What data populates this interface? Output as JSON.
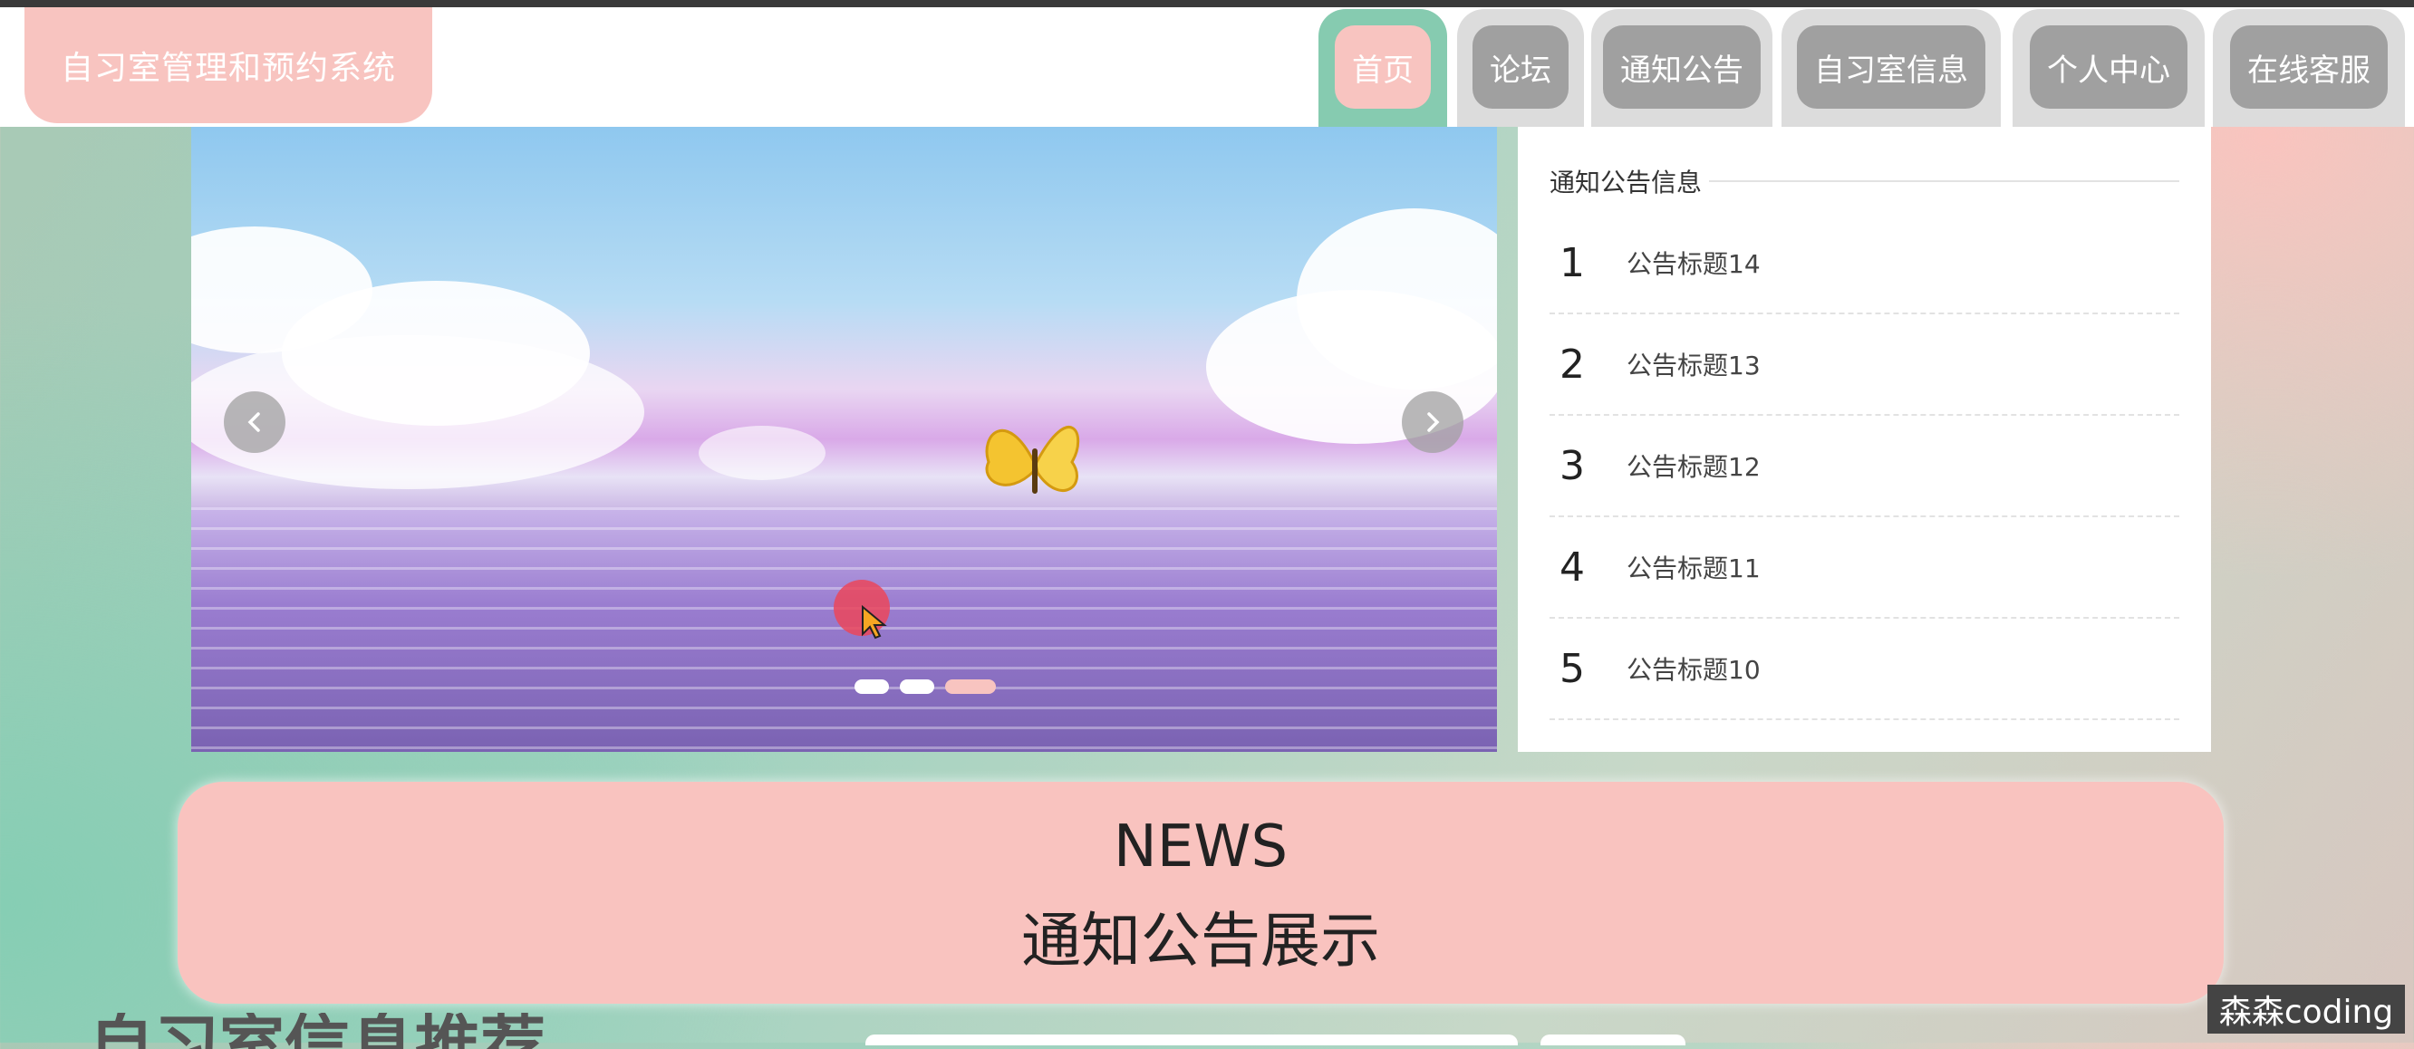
{
  "header": {
    "site_title": "自习室管理和预约系统",
    "nav": [
      {
        "label": "首页",
        "active": true
      },
      {
        "label": "论坛",
        "active": false
      },
      {
        "label": "通知公告",
        "active": false
      },
      {
        "label": "自习室信息",
        "active": false
      },
      {
        "label": "个人中心",
        "active": false
      },
      {
        "label": "在线客服",
        "active": false
      }
    ]
  },
  "carousel": {
    "slide_count": 3,
    "active_slide": 3,
    "prev_icon": "chevron-left-icon",
    "next_icon": "chevron-right-icon"
  },
  "notices": {
    "title": "通知公告信息",
    "items": [
      {
        "num": "1",
        "title": "公告标题14"
      },
      {
        "num": "2",
        "title": "公告标题13"
      },
      {
        "num": "3",
        "title": "公告标题12"
      },
      {
        "num": "4",
        "title": "公告标题11"
      },
      {
        "num": "5",
        "title": "公告标题10"
      }
    ]
  },
  "news_section": {
    "en_title": "NEWS",
    "cn_title": "通知公告展示"
  },
  "next_section_heading": "自习室信息推荐",
  "watermark": "森森coding",
  "colors": {
    "accent_pink": "#f8c4c0",
    "accent_green": "#86cbb0",
    "nav_gray": "#a0a0a0"
  }
}
